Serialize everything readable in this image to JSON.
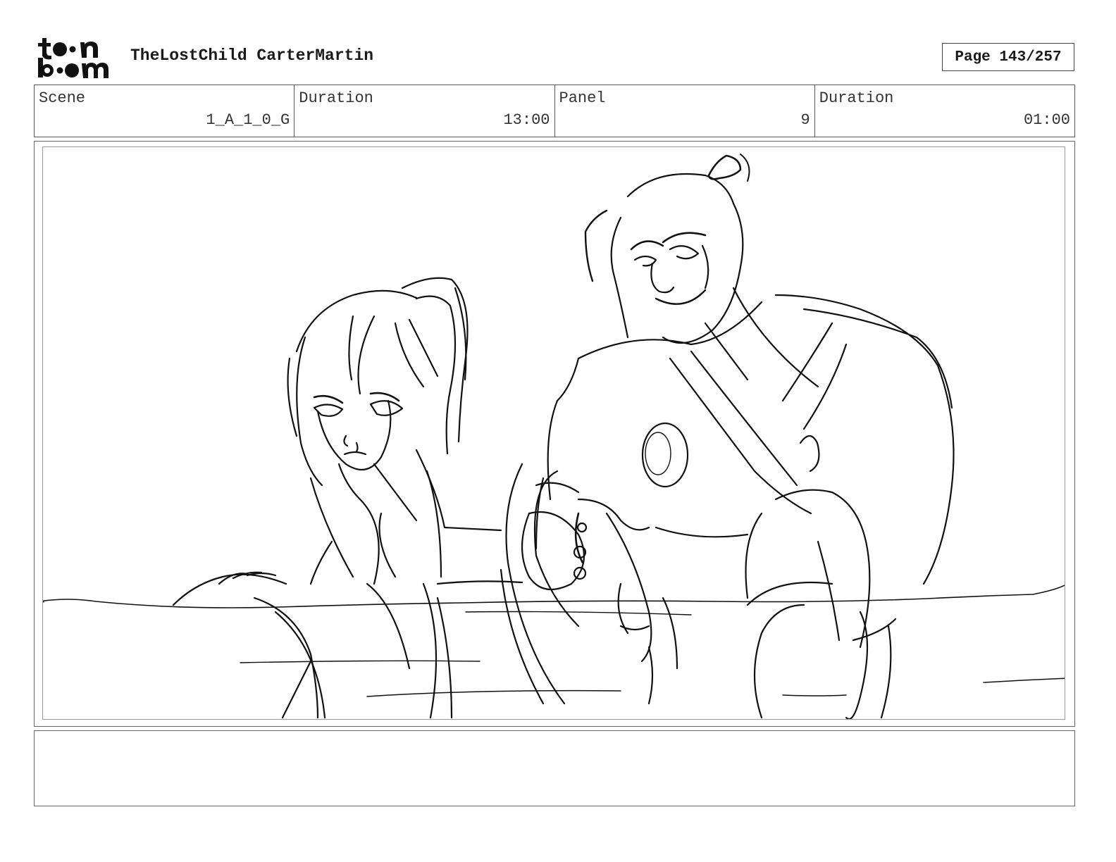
{
  "header": {
    "logo_top": "t●●n",
    "logo_bottom": "b●●m",
    "title": "TheLostChild CarterMartin",
    "page": "Page 143/257"
  },
  "info": {
    "scene_label": "Scene",
    "scene_value": "1_A_1_0_G",
    "scene_duration_label": "Duration",
    "scene_duration_value": "13:00",
    "panel_label": "Panel",
    "panel_value": "9",
    "panel_duration_label": "Duration",
    "panel_duration_value": "01:00"
  },
  "notes": {
    "text": ""
  }
}
